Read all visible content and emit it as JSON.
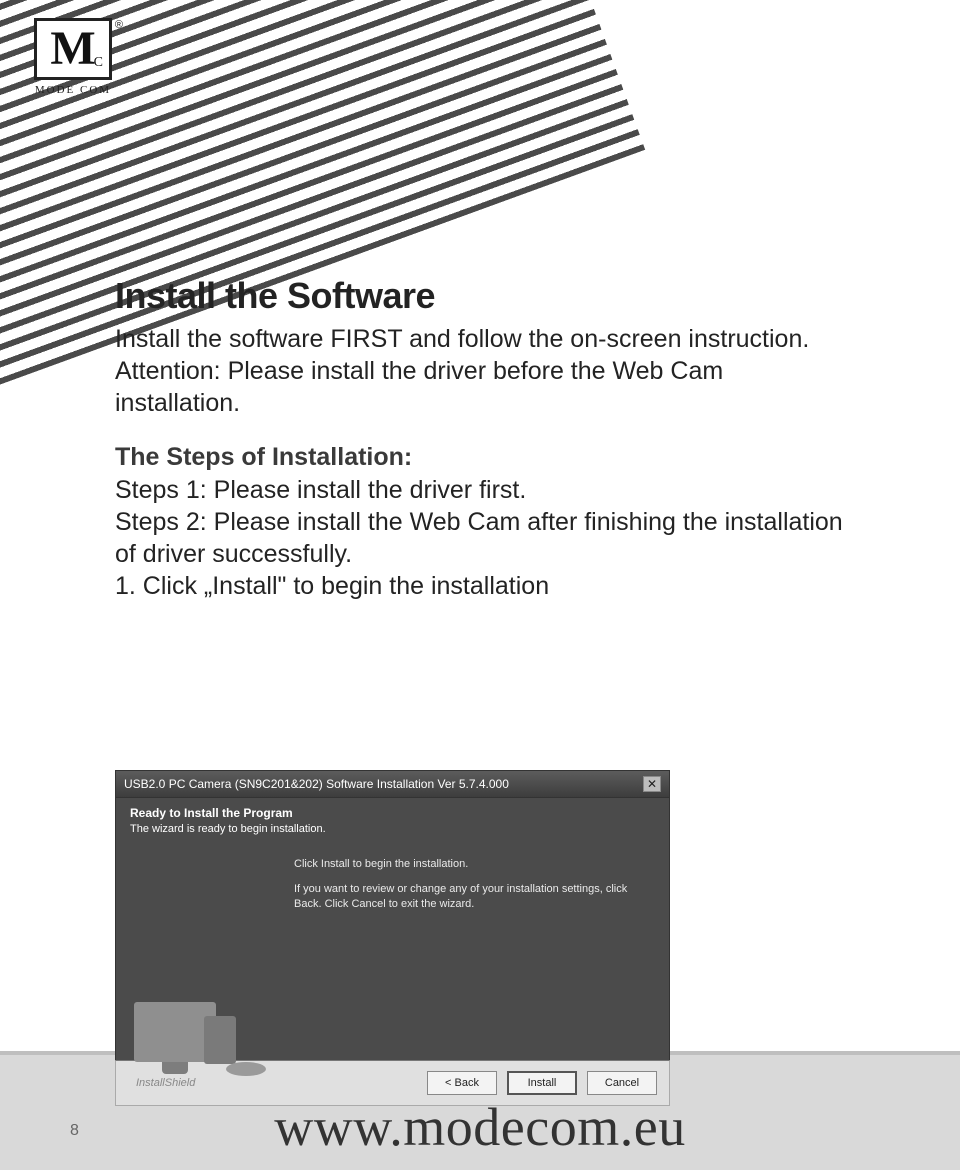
{
  "logo": {
    "big_letter": "M",
    "small_letter": "C",
    "reg_mark": "®",
    "subtext": "MODE COM"
  },
  "content": {
    "heading": "Install the Software",
    "intro": "Install the software FIRST and follow the on-screen instruction.",
    "attention": "Attention: Please install the driver before the Web Cam installation.",
    "steps_title": "The Steps of Installation:",
    "step1": "Steps 1: Please install the driver first.",
    "step2": "Steps 2: Please install the Web Cam after finishing the installation of driver successfully.",
    "click_install": "1. Click „Install\" to begin the installation"
  },
  "installer": {
    "titlebar": "USB2.0 PC Camera (SN9C201&202) Software Installation Ver 5.7.4.000",
    "close_glyph": "✕",
    "header_line1": "Ready to Install the Program",
    "header_line2": "The wizard is ready to begin installation.",
    "body_line1": "Click Install to begin the installation.",
    "body_line2": "If you want to review or change any of your installation settings, click Back. Click Cancel to exit the wizard.",
    "brand": "InstallShield",
    "btn_back": "< Back",
    "btn_install": "Install",
    "btn_cancel": "Cancel"
  },
  "footer": {
    "page_number": "8",
    "url": "www.modecom.eu"
  }
}
